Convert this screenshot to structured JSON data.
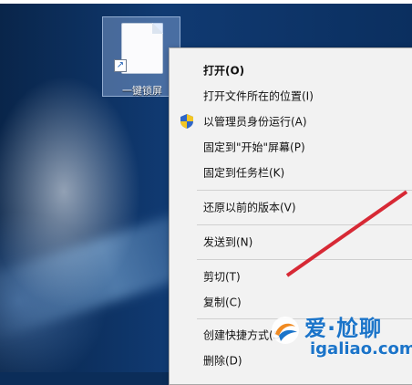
{
  "desktop": {
    "shortcut": {
      "label": "一键锁屏",
      "icon": "file-icon",
      "badge_icon": "shortcut-arrow-icon",
      "selected": true
    }
  },
  "context_menu": {
    "items": [
      {
        "label": "打开(O)",
        "bold": true
      },
      {
        "label": "打开文件所在的位置(I)"
      },
      {
        "label": "以管理员身份运行(A)",
        "icon": "uac-shield-icon"
      },
      {
        "label": "固定到\"开始\"屏幕(P)"
      },
      {
        "label": "固定到任务栏(K)"
      },
      {
        "label": "还原以前的版本(V)"
      },
      {
        "label": "发送到(N)",
        "submenu": true
      },
      {
        "label": "剪切(T)"
      },
      {
        "label": "复制(C)"
      },
      {
        "label": "创建快捷方式(S)"
      },
      {
        "label": "删除(D)"
      }
    ]
  },
  "watermark": {
    "text_cn": "爱·尬聊",
    "url": "igaliao.com",
    "logo_icon": "watermark-logo-icon"
  },
  "colors": {
    "menu_bg": "#f2f2f2",
    "menu_border": "#a7a7a7",
    "watermark_blue": "#1b74c9",
    "accent_red": "#d51d2a"
  }
}
